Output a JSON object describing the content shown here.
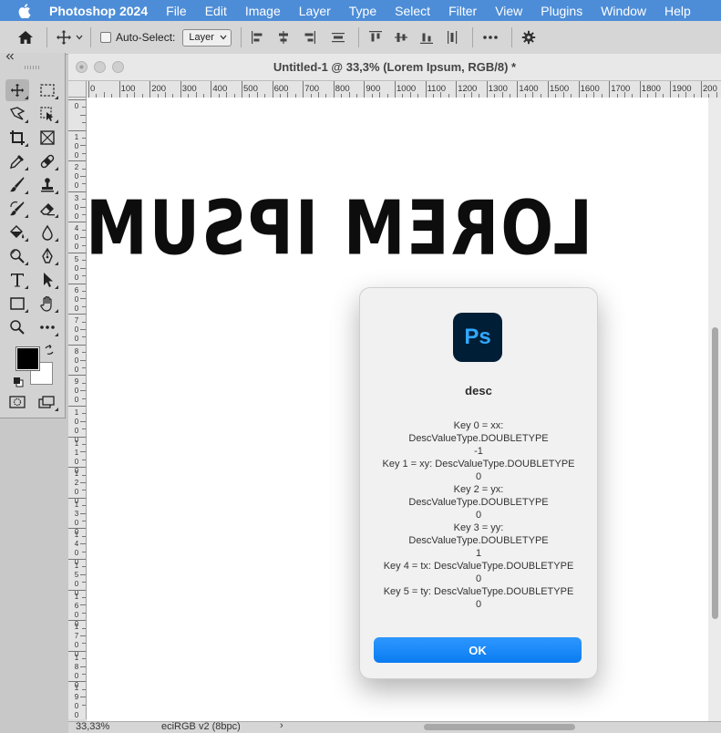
{
  "menubar": {
    "app_name": "Photoshop 2024",
    "items": [
      "File",
      "Edit",
      "Image",
      "Layer",
      "Type",
      "Select",
      "Filter",
      "View",
      "Plugins",
      "Window",
      "Help"
    ]
  },
  "options_bar": {
    "auto_select_label": "Auto-Select:",
    "auto_select_target": "Layer"
  },
  "document": {
    "title": "Untitled-1 @ 33,3% (Lorem Ipsum, RGB/8) *",
    "canvas_text": "LOREM IPSUM",
    "ruler_h_labels": [
      "0",
      "100",
      "200",
      "300",
      "400",
      "500",
      "600",
      "700",
      "800",
      "900",
      "1000",
      "1100",
      "1200",
      "1300",
      "1400",
      "1500",
      "1600",
      "1700",
      "1800",
      "1900",
      "200"
    ],
    "ruler_v_labels": [
      "0",
      "100",
      "200",
      "300",
      "400",
      "500",
      "600",
      "700",
      "800",
      "900",
      "1000",
      "1100",
      "1200",
      "1300",
      "1400",
      "1500",
      "1600",
      "1700",
      "1800",
      "1900"
    ],
    "zoom": "33,33%",
    "color_profile": "eciRGB v2 (8bpc)",
    "status_arrow": "›"
  },
  "dialog": {
    "title": "desc",
    "icon_label": "Ps",
    "lines": [
      "Key 0 = xx:",
      "DescValueType.DOUBLETYPE",
      "-1",
      "Key 1 = xy: DescValueType.DOUBLETYPE",
      "0",
      "Key 2 = yx:",
      "DescValueType.DOUBLETYPE",
      "0",
      "Key 3 = yy:",
      "DescValueType.DOUBLETYPE",
      "1",
      "Key 4 = tx: DescValueType.DOUBLETYPE",
      "0",
      "Key 5 = ty: DescValueType.DOUBLETYPE",
      "0"
    ],
    "ok_label": "OK"
  },
  "colors": {
    "menubar_bg": "#4d8dd8",
    "accent_button": "#0a7cf0",
    "ps_icon_bg": "#001e36",
    "ps_icon_fg": "#31a8ff"
  }
}
